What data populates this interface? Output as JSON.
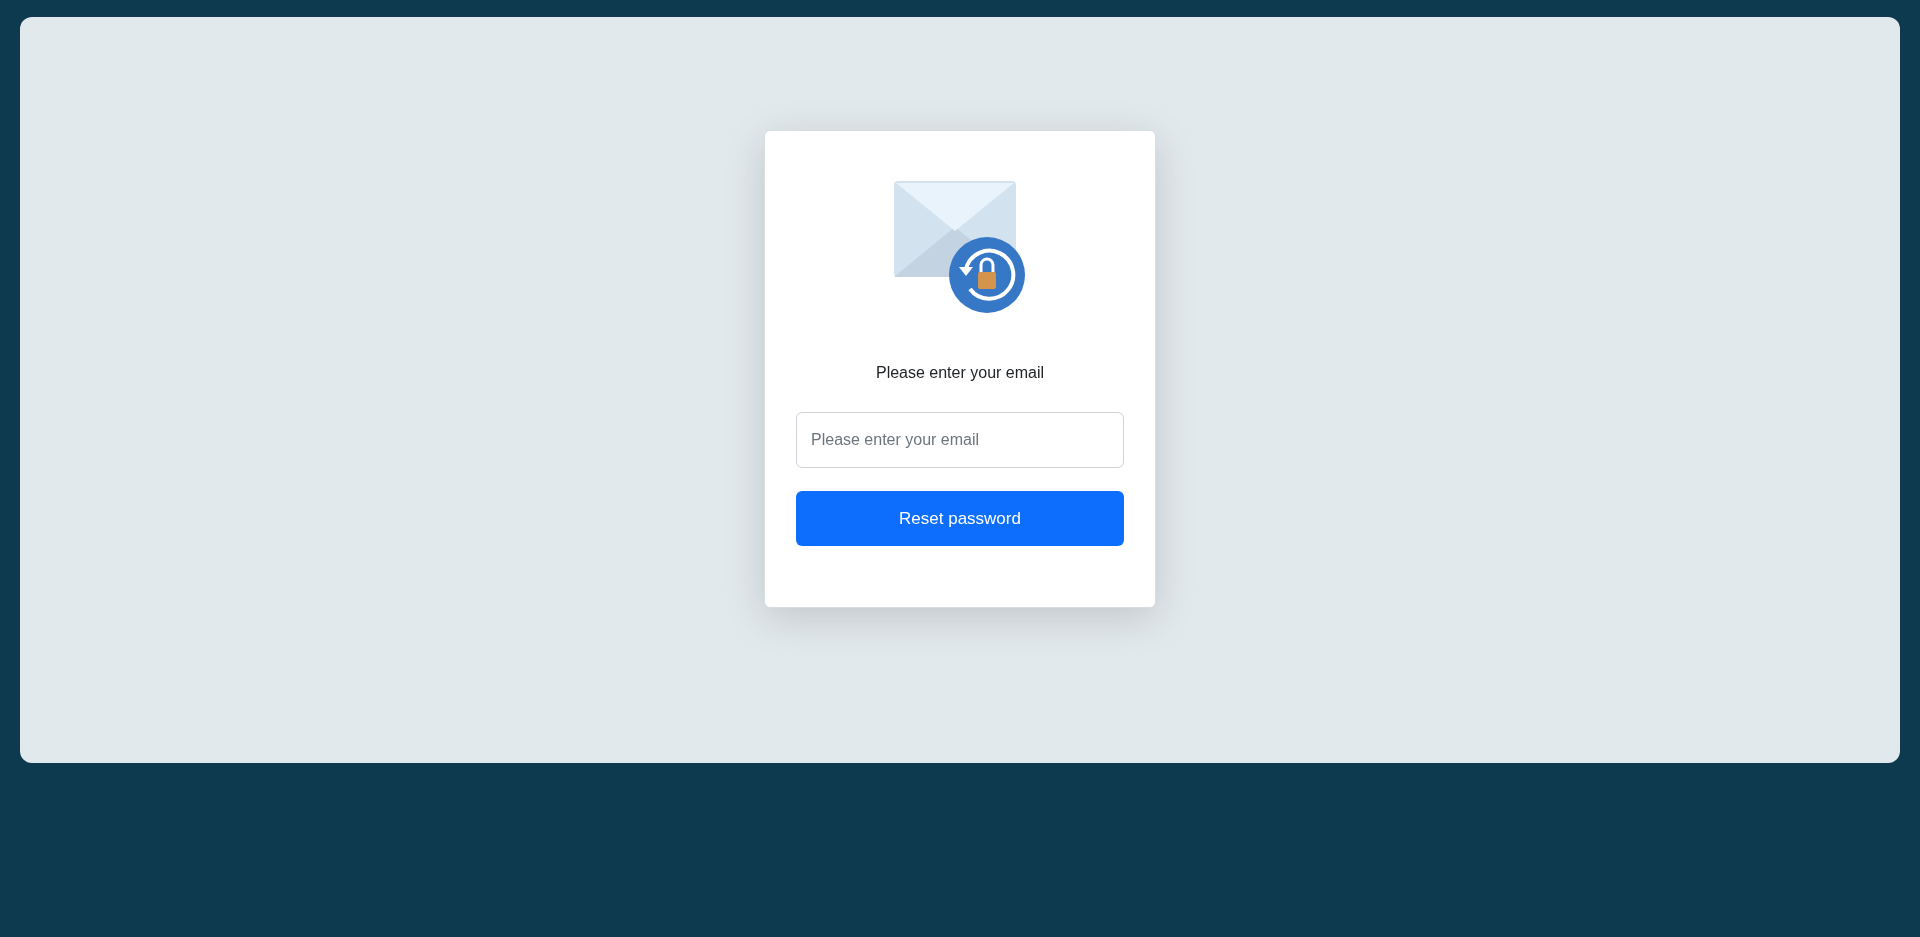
{
  "card": {
    "prompt": "Please enter your email",
    "email_field": {
      "placeholder": "Please enter your email"
    },
    "submit_button": {
      "label": "Reset password"
    }
  }
}
